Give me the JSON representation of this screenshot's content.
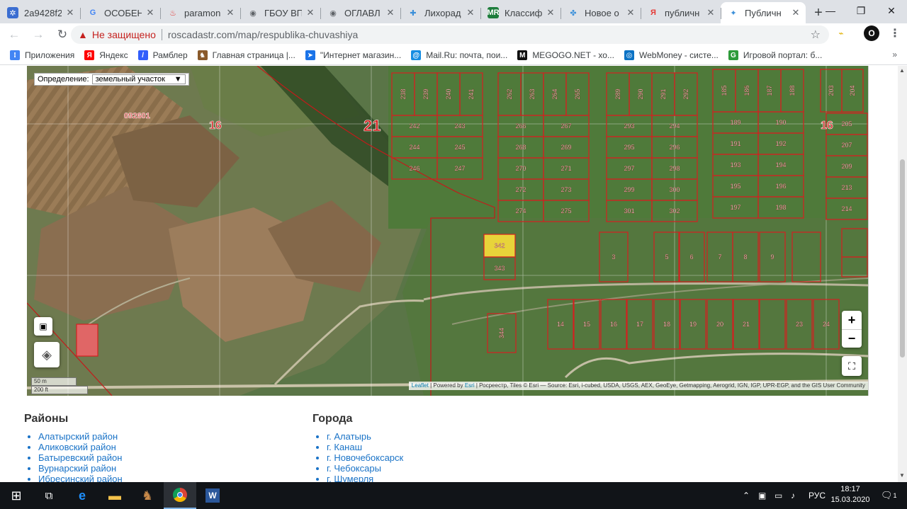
{
  "browser": {
    "tabs": [
      {
        "title": "2a9428f2",
        "icon": "gear-blue-icon",
        "color": "#3b6ed1",
        "glyph": "✲"
      },
      {
        "title": "ОСОБЕНН",
        "icon": "google-icon",
        "color": "#ffffff",
        "glyph": "G"
      },
      {
        "title": "paramon",
        "icon": "fire-icon",
        "color": "#ffffff",
        "glyph": "♨"
      },
      {
        "title": "ГБОУ ВП",
        "icon": "globe-icon",
        "color": "#ffffff",
        "glyph": "◉"
      },
      {
        "title": "ОГЛАВЛ",
        "icon": "globe-icon",
        "color": "#ffffff",
        "glyph": "◉"
      },
      {
        "title": "Лихорад",
        "icon": "cross-icon",
        "color": "#ffffff",
        "glyph": "✚"
      },
      {
        "title": "Классиф",
        "icon": "mr-icon",
        "color": "#1e7d3c",
        "glyph": "MR"
      },
      {
        "title": "Новое о",
        "icon": "dots-icon",
        "color": "#ffffff",
        "glyph": "✤"
      },
      {
        "title": "публичн",
        "icon": "yandex-icon",
        "color": "#ffffff",
        "glyph": "Я"
      },
      {
        "title": "Публичн",
        "icon": "rosreestr-icon",
        "color": "#ffffff",
        "glyph": "✦"
      }
    ],
    "omnibox": {
      "security_label": "Не защищено",
      "url": "roscadastr.com/map/respublika-chuvashiya"
    },
    "bookmarks": [
      {
        "label": "Приложения",
        "icon": "apps-icon",
        "color": "#4285f4",
        "glyph": "⁝"
      },
      {
        "label": "Яндекс",
        "icon": "yandex-icon",
        "color": "#ff0000",
        "glyph": "Я"
      },
      {
        "label": "Рамблер",
        "icon": "rambler-icon",
        "color": "#315efb",
        "glyph": "/"
      },
      {
        "label": "Главная страница |...",
        "icon": "horse-icon",
        "color": "#8a5a2b",
        "glyph": "♞"
      },
      {
        "label": "\"Интернет магазин...",
        "icon": "bird-icon",
        "color": "#1a73e8",
        "glyph": "➤"
      },
      {
        "label": "Mail.Ru: почта, пои...",
        "icon": "mailru-icon",
        "color": "#168de2",
        "glyph": "@"
      },
      {
        "label": "MEGOGO.NET - хо...",
        "icon": "megogo-icon",
        "color": "#111111",
        "glyph": "M"
      },
      {
        "label": "WebMoney - систе...",
        "icon": "webmoney-icon",
        "color": "#0b72c4",
        "glyph": "◎"
      },
      {
        "label": "Игровой портал: б...",
        "icon": "game-icon",
        "color": "#2e9b3a",
        "glyph": "G"
      }
    ]
  },
  "map": {
    "definition_label": "Определение:",
    "definition_value": "земельный участок",
    "quarter_label": "092601",
    "block_numbers": [
      "16",
      "21",
      "16"
    ],
    "scale_m": "50 m",
    "scale_ft": "200 ft",
    "attribution": {
      "leaflet": "Leaflet",
      "powered": "| Powered by",
      "esri": "Esri",
      "rest": "| Росреестр, Tiles © Esri — Source: Esri, i-cubed, USDA, USGS, AEX, GeoEye, Getmapping, Aerogrid, IGN, IGP, UPR-EGP, and the GIS User Community"
    },
    "zoom_in": "+",
    "zoom_out": "−",
    "highlight_color": "#e8d43a",
    "parcel_color": "#d42020"
  },
  "districts": {
    "heading": "Районы",
    "items": [
      "Алатырский район",
      "Аликовский район",
      "Батыревский район",
      "Вурнарский район",
      "Ибресинский район"
    ]
  },
  "cities": {
    "heading": "Города",
    "items": [
      "г. Алатырь",
      "г. Канаш",
      "г. Новочебоксарск",
      "г. Чебоксары",
      "г. Шумерля"
    ]
  },
  "taskbar": {
    "lang": "РУС",
    "time": "18:17",
    "date": "15.03.2020",
    "notif_count": "1"
  }
}
